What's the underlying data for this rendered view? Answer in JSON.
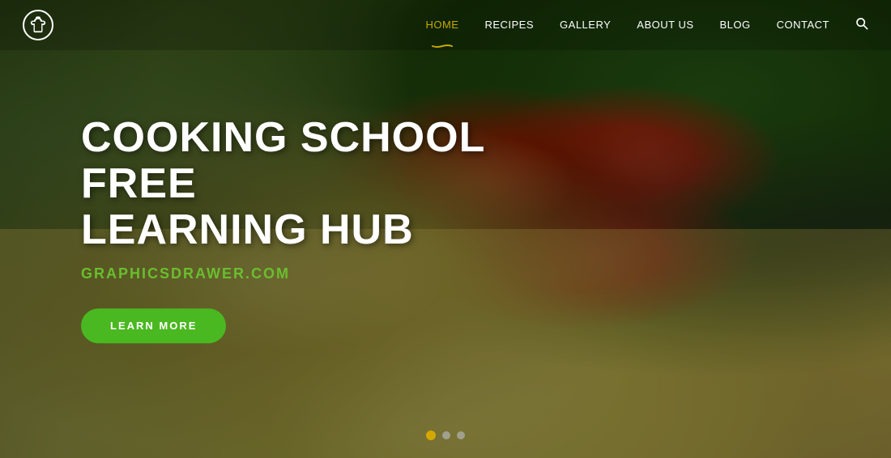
{
  "navbar": {
    "logo_icon": "🍳",
    "links": [
      {
        "label": "HOME",
        "active": true,
        "id": "home"
      },
      {
        "label": "RECIPES",
        "active": false,
        "id": "recipes"
      },
      {
        "label": "GALLERY",
        "active": false,
        "id": "gallery"
      },
      {
        "label": "ABOUT US",
        "active": false,
        "id": "about"
      },
      {
        "label": "BLOG",
        "active": false,
        "id": "blog"
      },
      {
        "label": "CONTACT",
        "active": false,
        "id": "contact"
      }
    ]
  },
  "hero": {
    "title_line1": "COOKING SCHOOL FREE",
    "title_line2": "LEARNING HUB",
    "subtitle": "GRAPHICSDRAWER.COM",
    "cta_label": "LEARN MORE"
  },
  "slider": {
    "dots": [
      {
        "active": true
      },
      {
        "active": false
      },
      {
        "active": false
      }
    ]
  },
  "colors": {
    "active_nav": "#c8a800",
    "green_accent": "#6abf2e",
    "cta_bg": "#4ab820",
    "dot_active": "#d4a800"
  }
}
